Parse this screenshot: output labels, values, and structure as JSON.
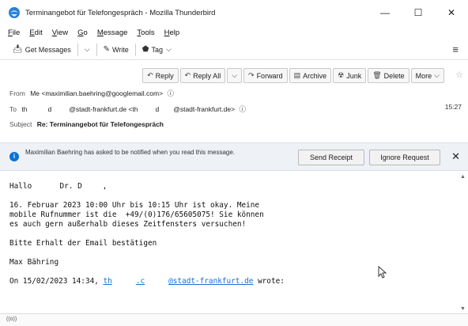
{
  "window": {
    "title": "Terminangebot für Telefongespräch - Mozilla Thunderbird",
    "min": "—",
    "max": "☐",
    "close": "✕"
  },
  "menu": {
    "items": [
      {
        "accel": "F",
        "rest": "ile"
      },
      {
        "accel": "E",
        "rest": "dit"
      },
      {
        "accel": "V",
        "rest": "iew"
      },
      {
        "accel": "G",
        "rest": "o"
      },
      {
        "accel": "M",
        "rest": "essage"
      },
      {
        "accel": "T",
        "rest": "ools"
      },
      {
        "accel": "H",
        "rest": "elp"
      }
    ]
  },
  "toolbar": {
    "get_messages": "Get Messages",
    "write": "Write",
    "tag": "Tag"
  },
  "actions": {
    "reply": "Reply",
    "reply_all": "Reply All",
    "forward": "Forward",
    "archive": "Archive",
    "junk": "Junk",
    "delete": "Delete",
    "more": "More"
  },
  "header": {
    "from_label": "From",
    "from_value": "Me <maximilian.baehring@googlemail.com>",
    "to_label": "To",
    "to_part1": "th",
    "to_part2": "d",
    "to_part3": "@stadt-frankfurt.de <th",
    "to_part4": "d",
    "to_part5": "@stadt-frankfurt.de>",
    "time": "15:27",
    "subject_label": "Subject",
    "subject_value": "Re: Terminangebot für Telefongespräch"
  },
  "notification": {
    "text": "Maximilian Baehring has asked to be notified when you read this message.",
    "send_receipt": "Send Receipt",
    "ignore_request": "Ignore Request"
  },
  "body": {
    "greeting_a": "Hallo ",
    "greeting_b": " Dr. D",
    "greeting_c": ",",
    "line1": "16. Februar 2023 10:00 Uhr bis 10:15 Uhr ist okay. Meine",
    "line2": "mobile Rufnummer ist die  +49/(0)176/65605075! Sie können",
    "line3": "es auch gern außerhalb dieses Zeitfensters versuchen!",
    "line4": "Bitte Erhalt der Email bestätigen",
    "signature": "Max Bähring",
    "quote_prefix": "On 15/02/2023 14:34, ",
    "quote_link_a": "th",
    "quote_link_b": ".c",
    "quote_link_c": "@stadt-frankfurt.de",
    "quote_suffix": " wrote:"
  },
  "status": {
    "icon": "((o))"
  },
  "colors": {
    "accent": "#0a72d8",
    "link": "#1a6fd1",
    "notification_bg": "#eef1f6"
  }
}
